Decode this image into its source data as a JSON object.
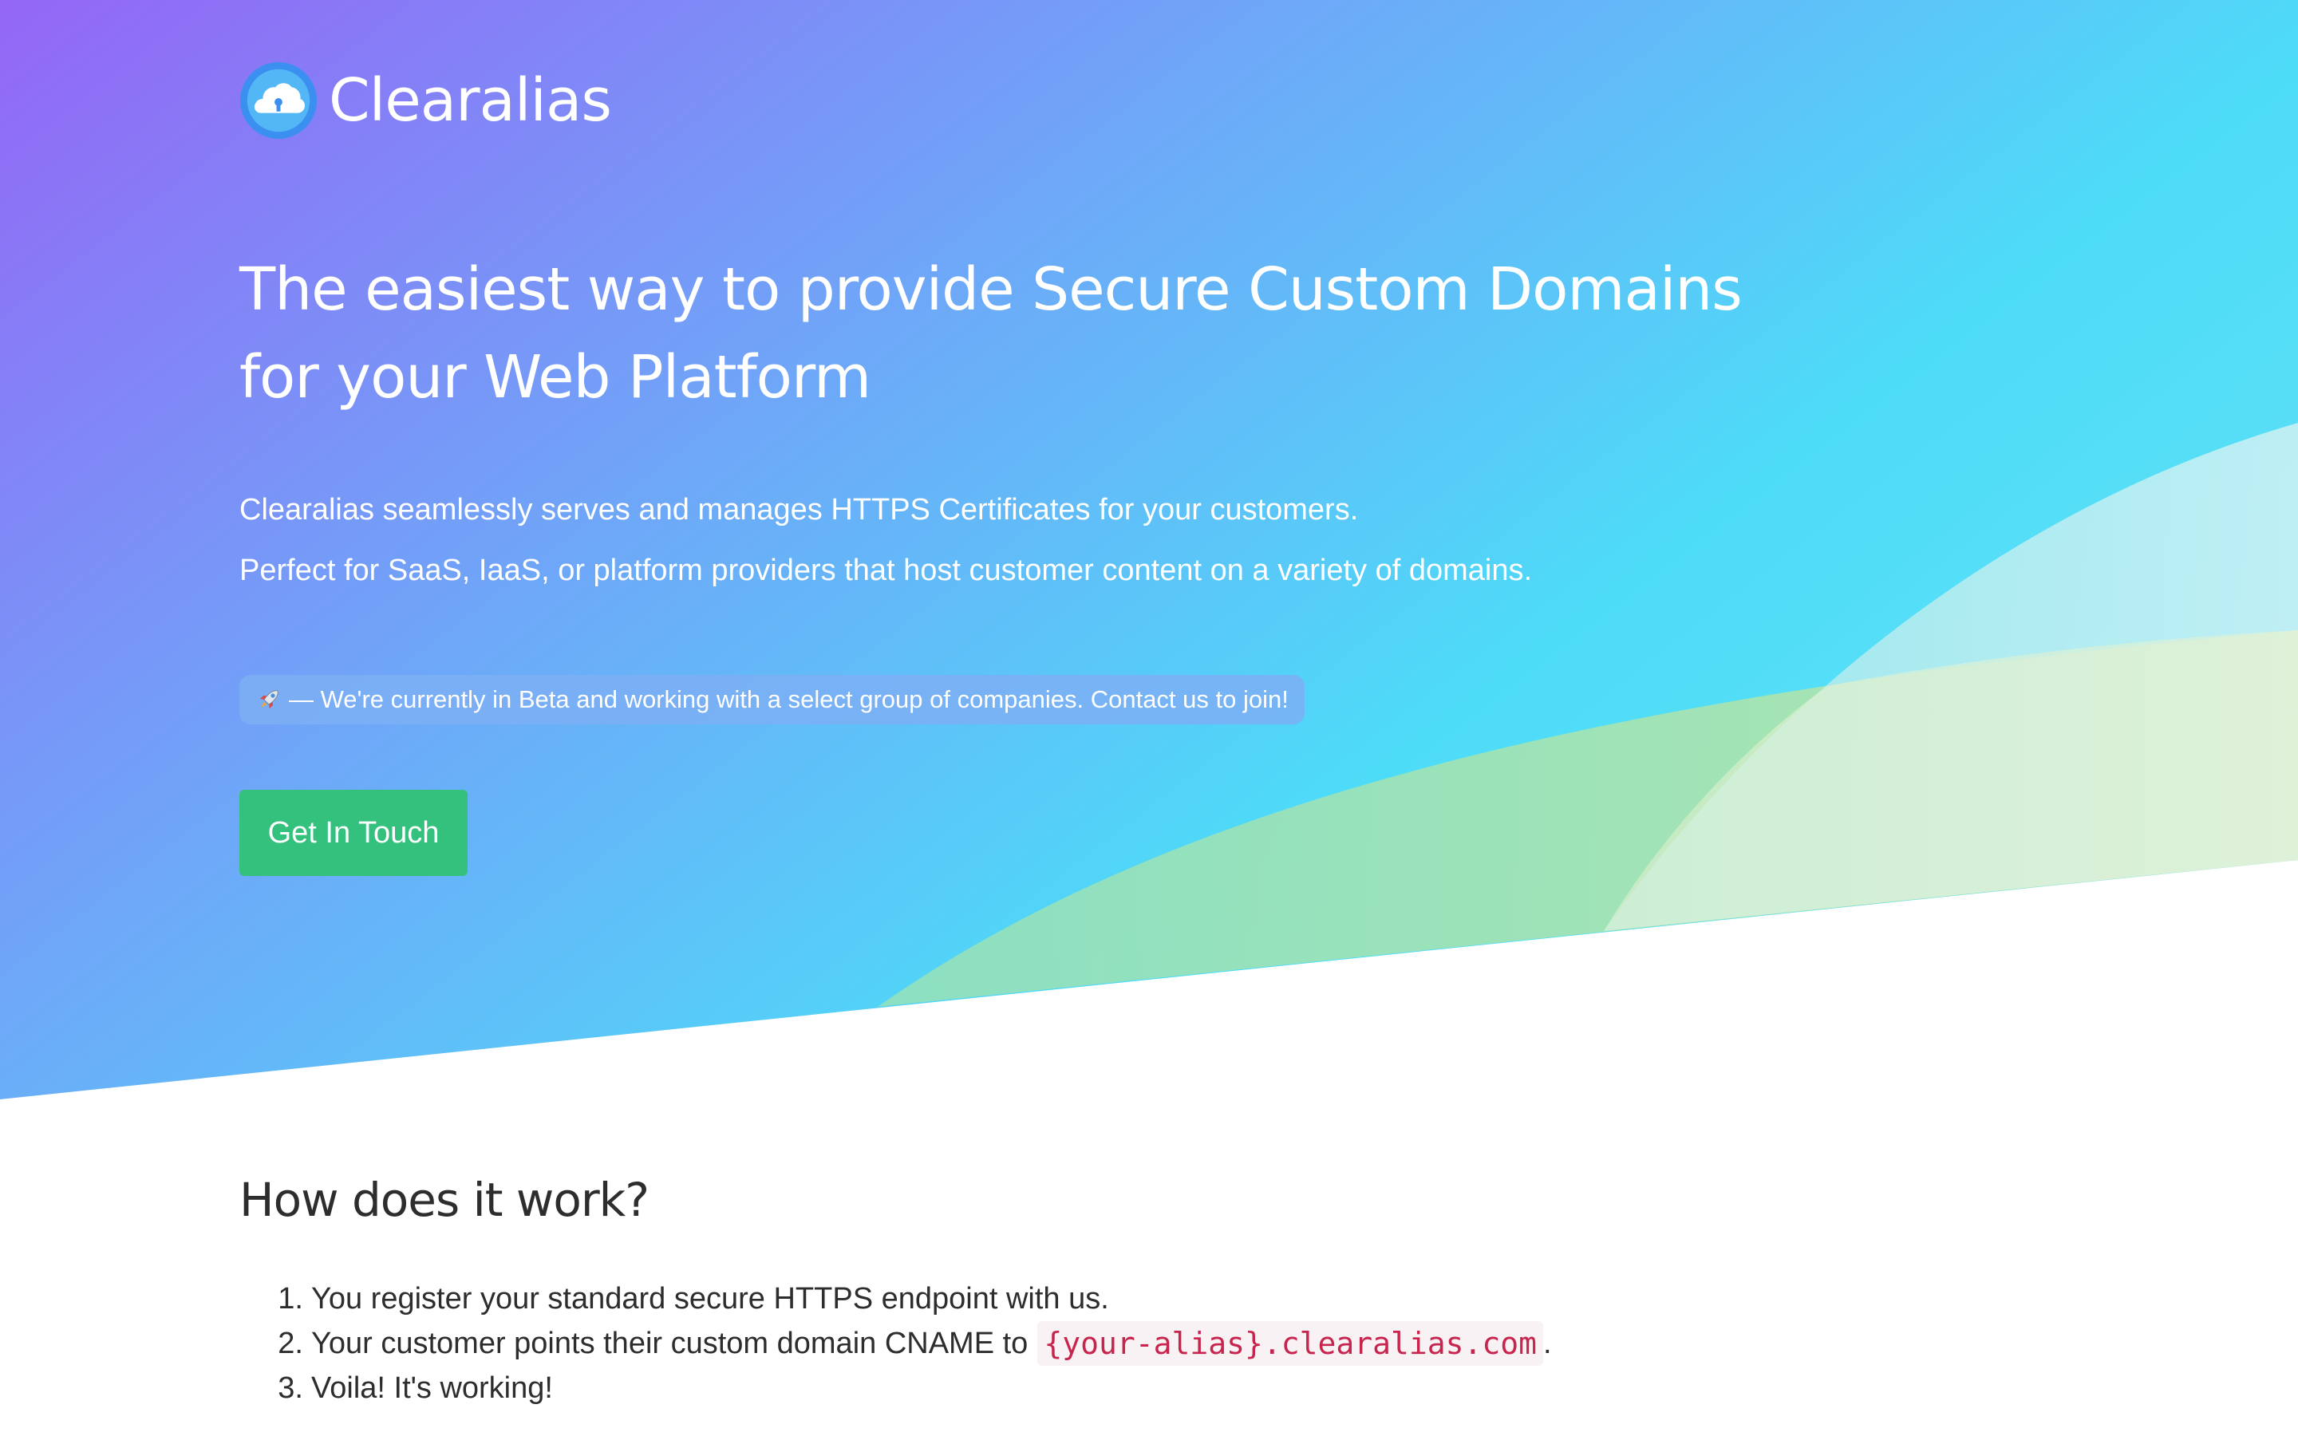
{
  "brand": {
    "name": "Clearalias"
  },
  "hero": {
    "headline_line1": "The easiest way to provide Secure Custom Domains",
    "headline_line2": "for your Web Platform",
    "subtext_line1": "Clearalias seamlessly serves and manages HTTPS Certificates for your customers.",
    "subtext_line2": "Perfect for SaaS, IaaS, or platform providers that host customer content on a variety of domains.",
    "beta_notice": "— We're currently in Beta and working with a select group of companies. Contact us to join!",
    "cta_label": "Get In Touch"
  },
  "how_it_works": {
    "title": "How does it work?",
    "steps": [
      {
        "num": "1.",
        "text": "You register your standard secure HTTPS endpoint with us."
      },
      {
        "num": "2.",
        "text": "Your customer points their custom domain CNAME to",
        "code": "{your-alias}.clearalias.com",
        "suffix": "."
      },
      {
        "num": "3.",
        "text": "Voila! It's working!"
      }
    ]
  },
  "colors": {
    "gradient_start": "#9466f6",
    "gradient_mid": "#6aaef8",
    "gradient_end": "#4ddcf8",
    "cta": "#33c17d",
    "code_text": "#c7254e",
    "code_bg": "#f9f2f4"
  },
  "icons": {
    "logo": "cloud-lock-icon",
    "beta": "rocket-icon"
  }
}
